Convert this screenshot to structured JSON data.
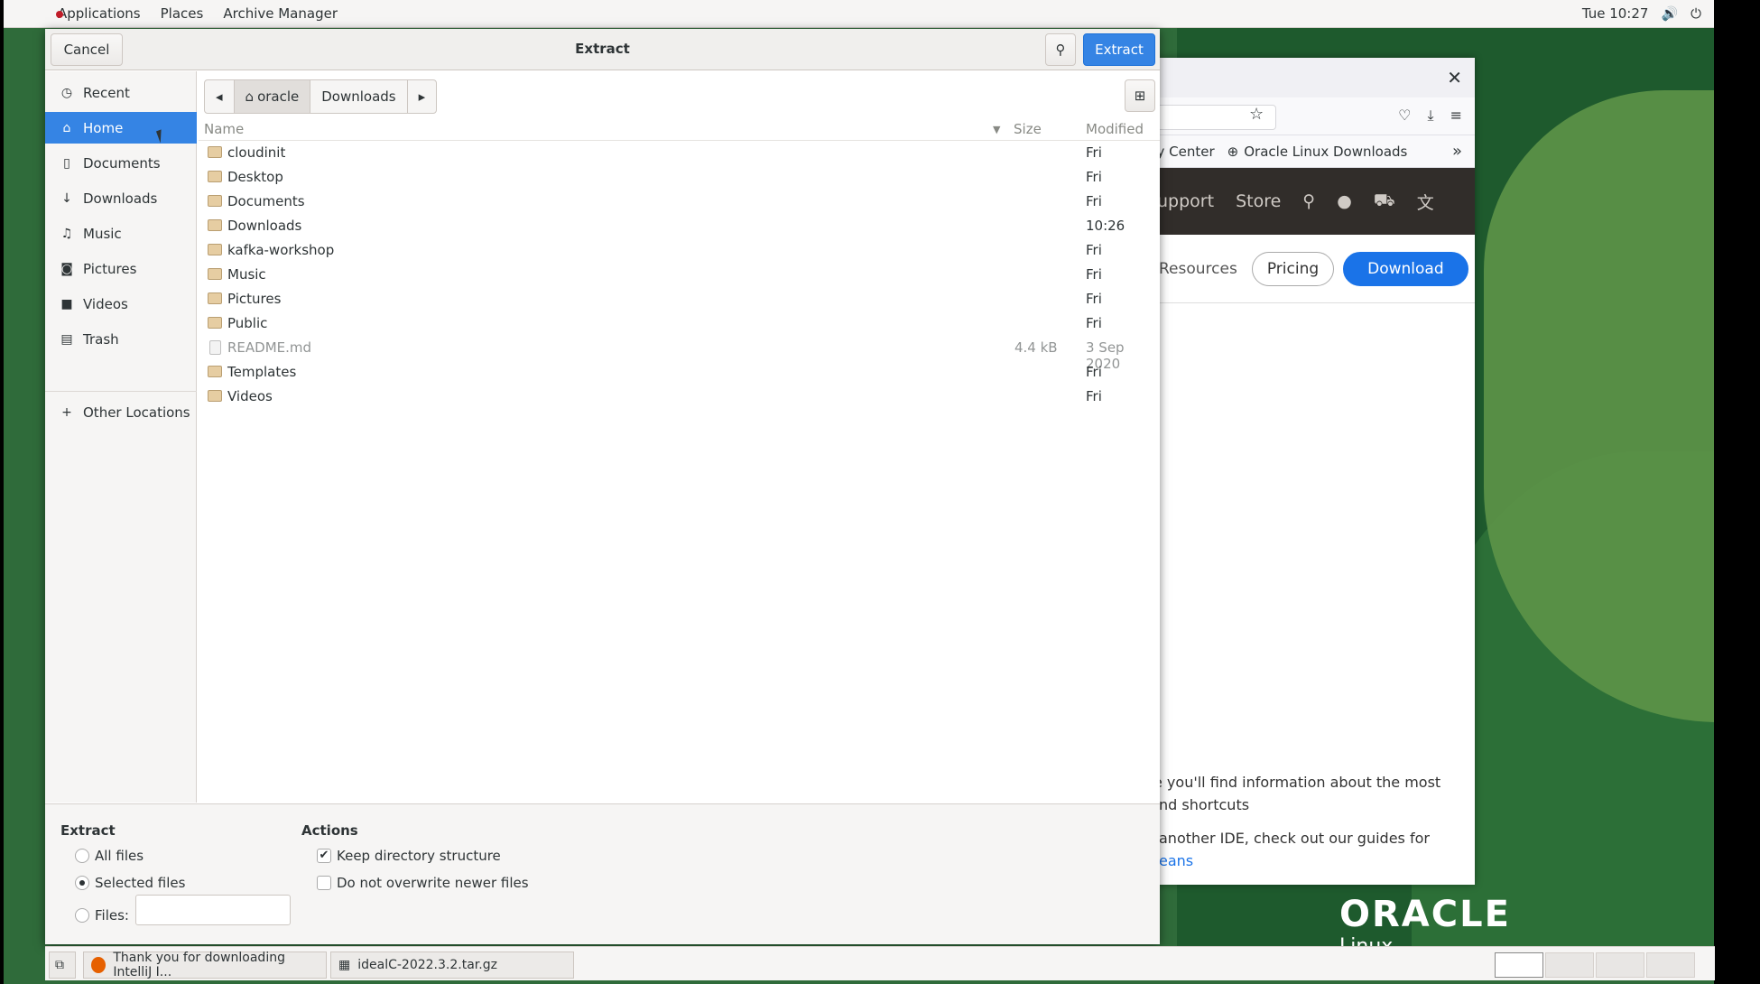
{
  "topbar": {
    "applications": "Applications",
    "places": "Places",
    "archive_manager": "Archive Manager",
    "clock": "Tue 10:27"
  },
  "browser": {
    "bookmark1": "gy Center",
    "bookmark2": "Oracle Linux Downloads",
    "nav_support": "upport",
    "nav_store": "Store",
    "resources": "Resources",
    "pricing": "Pricing",
    "download": "Download",
    "text1": "e you'll find information about the most",
    "text2": "nd shortcuts",
    "text3": "another IDE, check out our guides for",
    "text4": "eans",
    "brand": "ORACLE",
    "brand_sub": "Linux"
  },
  "dialog": {
    "title": "Extract",
    "cancel": "Cancel",
    "extract": "Extract"
  },
  "sidebar": {
    "items": [
      {
        "label": "Recent",
        "icon": "clock-icon"
      },
      {
        "label": "Home",
        "icon": "home-icon"
      },
      {
        "label": "Documents",
        "icon": "document-icon"
      },
      {
        "label": "Downloads",
        "icon": "download-icon"
      },
      {
        "label": "Music",
        "icon": "music-icon"
      },
      {
        "label": "Pictures",
        "icon": "camera-icon"
      },
      {
        "label": "Videos",
        "icon": "video-icon"
      },
      {
        "label": "Trash",
        "icon": "trash-icon"
      }
    ],
    "other": "Other Locations"
  },
  "path": {
    "home": "oracle",
    "current": "Downloads"
  },
  "columns": {
    "name": "Name",
    "size": "Size",
    "modified": "Modified"
  },
  "files": [
    {
      "name": "cloudinit",
      "size": "",
      "modified": "Fri"
    },
    {
      "name": "Desktop",
      "size": "",
      "modified": "Fri"
    },
    {
      "name": "Documents",
      "size": "",
      "modified": "Fri"
    },
    {
      "name": "Downloads",
      "size": "",
      "modified": "10:26"
    },
    {
      "name": "kafka-workshop",
      "size": "",
      "modified": "Fri"
    },
    {
      "name": "Music",
      "size": "",
      "modified": "Fri"
    },
    {
      "name": "Pictures",
      "size": "",
      "modified": "Fri"
    },
    {
      "name": "Public",
      "size": "",
      "modified": "Fri"
    },
    {
      "name": "README.md",
      "size": "4.4 kB",
      "modified": "3 Sep 2020"
    },
    {
      "name": "Templates",
      "size": "",
      "modified": "Fri"
    },
    {
      "name": "Videos",
      "size": "",
      "modified": "Fri"
    }
  ],
  "options": {
    "extract_label": "Extract",
    "all_files": "All files",
    "selected_files": "Selected files",
    "files": "Files:",
    "actions_label": "Actions",
    "keep_structure": "Keep directory structure",
    "no_overwrite": "Do not overwrite newer files"
  },
  "taskbar": {
    "firefox": "Thank you for downloading IntelliJ I...",
    "archive": "idealC-2022.3.2.tar.gz"
  }
}
